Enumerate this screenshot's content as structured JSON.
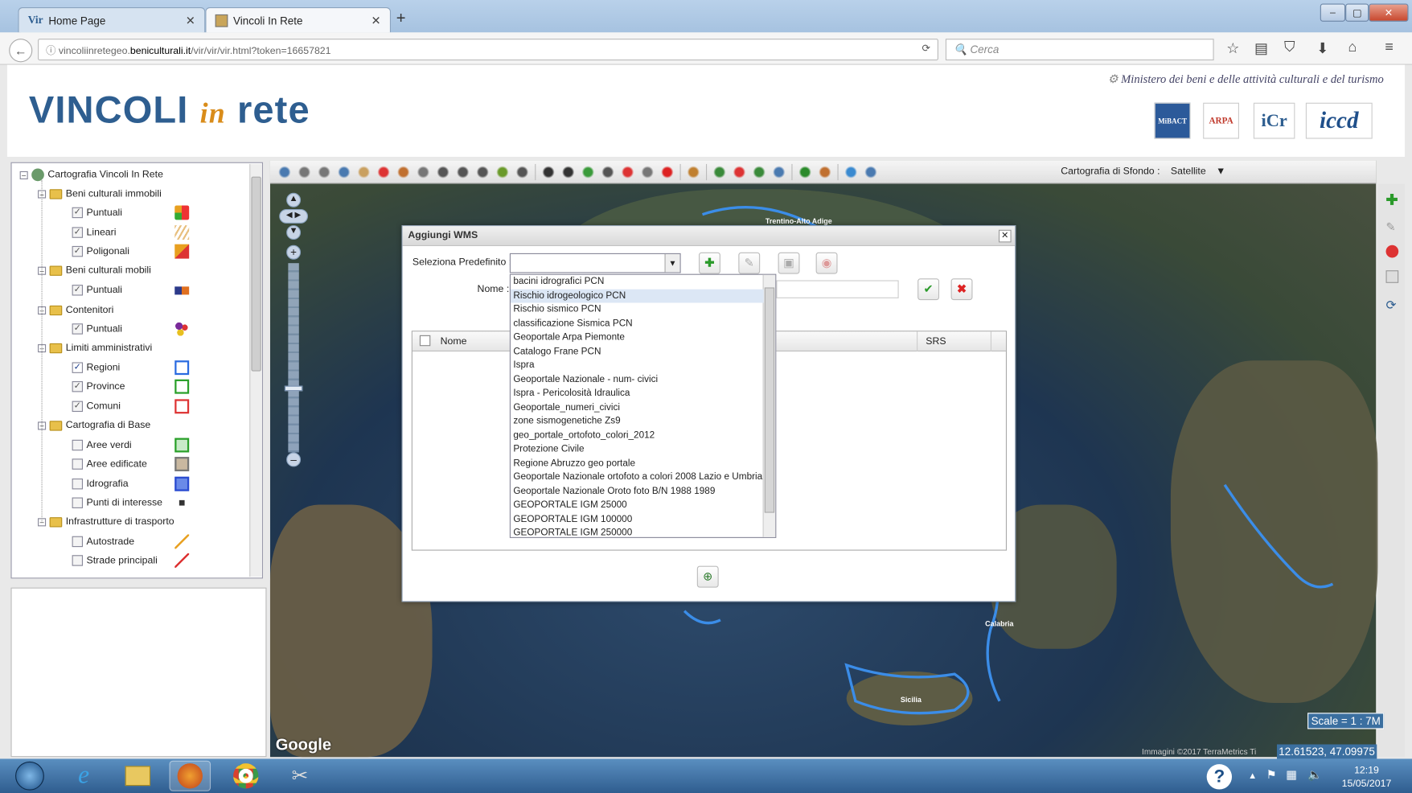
{
  "browser": {
    "tabs": [
      {
        "label": "Home Page",
        "favicon": "Vir"
      },
      {
        "label": "Vincoli In Rete"
      }
    ],
    "url_prefix": "vincoliinretegeo.",
    "url_domain": "beniculturali.it",
    "url_path": "/vir/vir/vir.html?token=16657821",
    "search_placeholder": "Cerca"
  },
  "header": {
    "logo_main": "VINCOLI",
    "logo_in": "in",
    "logo_rete": "rete",
    "ministero": "Ministero dei beni e delle attività culturali e del turismo",
    "partners": [
      "MiBACT",
      "ARPA",
      "iCr",
      "iccd"
    ]
  },
  "tree": {
    "root": "Cartografia Vincoli In Rete",
    "groups": [
      {
        "label": "Beni culturali immobili",
        "items": [
          "Puntuali",
          "Lineari",
          "Poligonali"
        ]
      },
      {
        "label": "Beni culturali mobili",
        "items": [
          "Puntuali"
        ]
      },
      {
        "label": "Contenitori",
        "items": [
          "Puntuali"
        ]
      },
      {
        "label": "Limiti amministrativi",
        "items": [
          "Regioni",
          "Province",
          "Comuni"
        ]
      },
      {
        "label": "Cartografia di Base",
        "items": [
          "Aree verdi",
          "Aree edificate",
          "Idrografia",
          "Punti di interesse"
        ]
      },
      {
        "label": "Infrastrutture di trasporto",
        "items": [
          "Autostrade",
          "Strade principali"
        ]
      }
    ]
  },
  "map": {
    "sfondo_label": "Cartografia di Sfondo :",
    "sfondo_value": "Satellite",
    "google": "Google",
    "scale": "Scale = 1 : 7M",
    "coords": "12.61523, 47.09975",
    "attribution": "Immagini ©2017 TerraMetrics",
    "attribution_tail": "Ti",
    "place_labels": [
      "Trentino-Alto Adige",
      "Calabria",
      "Sicilia"
    ]
  },
  "dialog": {
    "title": "Aggiungi WMS",
    "seleziona_label": "Seleziona Predefinito :",
    "nome_label": "Nome :",
    "col_nome": "Nome",
    "col_srs": "SRS",
    "options": [
      "bacini idrografici PCN",
      "Rischio idrogeologico PCN",
      "Rischio sismico PCN",
      "classificazione Sismica PCN",
      "Geoportale Arpa Piemonte",
      "Catalogo Frane PCN",
      "Ispra",
      "Geoportale Nazionale - num- civici",
      "Ispra - Pericolosità Idraulica",
      "Geoportale_numeri_civici",
      "zone sismogenetiche Zs9",
      "geo_portale_ortofoto_colori_2012",
      "Protezione Civile",
      "Regione Abruzzo geo portale",
      "Geoportale Nazionale ortofoto a colori 2008 Lazio e Umbria",
      "Geoportale Nazionale Oroto foto B/N 1988 1989",
      "GEOPORTALE IGM 25000",
      "GEOPORTALE IGM 100000",
      "GEOPORTALE IGM 250000"
    ],
    "highlighted_index": 1
  },
  "taskbar": {
    "time": "12:19",
    "date": "15/05/2017"
  },
  "colors": {
    "accent": "#2e5e90",
    "highlight": "#dce7f5"
  }
}
